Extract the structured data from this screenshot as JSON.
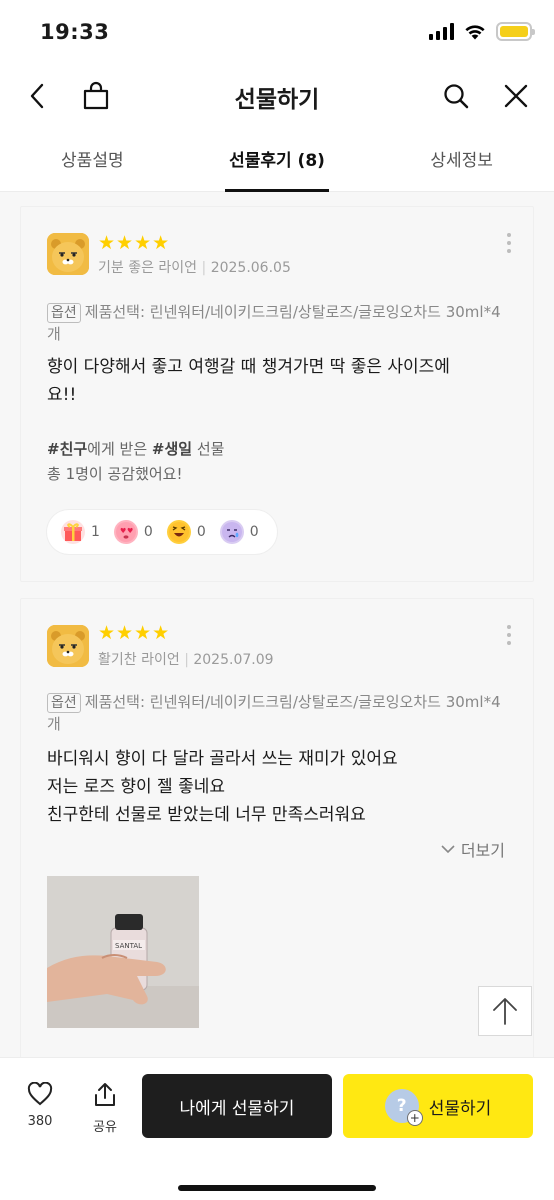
{
  "status_bar": {
    "time": "19:33"
  },
  "header": {
    "title": "선물하기"
  },
  "tabs": [
    {
      "label": "상품설명",
      "active": false
    },
    {
      "label": "선물후기 (8)",
      "active": true
    },
    {
      "label": "상세정보",
      "active": false
    }
  ],
  "reviews": [
    {
      "stars": 4,
      "reviewer": "기분 좋은 라이언",
      "date": "2025.06.05",
      "option_badge": "옵션",
      "option_text": "제품선택: 린넨워터/네이키드크림/상탈로즈/글로잉오차드 30ml*4개",
      "text_lines": [
        "향이 다양해서 좋고 여행갈 때 챙겨가면 딱 좋은 사이즈에",
        "요!!"
      ],
      "gift_prefix_1": "#친구",
      "gift_mid": "에게 받은 ",
      "gift_prefix_2": "#생일",
      "gift_suffix": " 선물",
      "empathy": "총 1명이 공감했어요!",
      "reactions": [
        {
          "icon": "gift-reaction-icon",
          "count": "1"
        },
        {
          "icon": "heart-eyes-reaction-icon",
          "count": "0"
        },
        {
          "icon": "laughing-reaction-icon",
          "count": "0"
        },
        {
          "icon": "sad-reaction-icon",
          "count": "0"
        }
      ]
    },
    {
      "stars": 4,
      "reviewer": "활기찬 라이언",
      "date": "2025.07.09",
      "option_badge": "옵션",
      "option_text": "제품선택: 린넨워터/네이키드크림/상탈로즈/글로잉오차드 30ml*4개",
      "text_lines": [
        "바디워시 향이 다 달라 골라서 쓰는 재미가 있어요",
        "저는 로즈 향이 젤 좋네요",
        "친구한테 선물로 받았는데 너무 만족스러워요"
      ],
      "more_label": "더보기"
    }
  ],
  "bottom_bar": {
    "like_count": "380",
    "share_label": "공유",
    "gift_to_me_label": "나에게 선물하기",
    "gift_label": "선물하기"
  },
  "colors": {
    "accent_yellow": "#ffe812",
    "star_yellow": "#ffcf00",
    "dark_button": "#1e1e1e"
  }
}
